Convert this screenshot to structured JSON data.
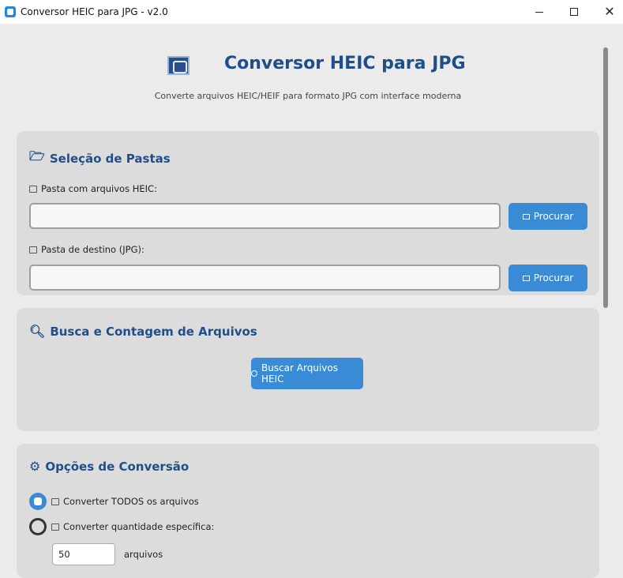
{
  "window": {
    "title": "Conversor HEIC para JPG - v2.0"
  },
  "header": {
    "title": "Conversor HEIC para JPG",
    "subtitle": "Converte arquivos HEIC/HEIF para formato JPG com interface moderna"
  },
  "folders": {
    "title": "Seleção de Pastas",
    "source_label": "Pasta com arquivos HEIC:",
    "source_value": "",
    "dest_label": "Pasta de destino (JPG):",
    "dest_value": "",
    "browse_label": "Procurar"
  },
  "search": {
    "title": "Busca e Contagem de Arquivos",
    "button_label": "Buscar Arquivos HEIC"
  },
  "options": {
    "title": "Opções de Conversão",
    "radio_all_label": "Converter TODOS os arquivos",
    "radio_qty_label": "Converter quantidade específica:",
    "selected": "all",
    "quantity_value": "50",
    "quantity_unit": "arquivos"
  },
  "colors": {
    "accent": "#3a8bd6",
    "heading": "#1f4f8a",
    "card": "#dcdcdc",
    "background": "#ebebeb"
  }
}
